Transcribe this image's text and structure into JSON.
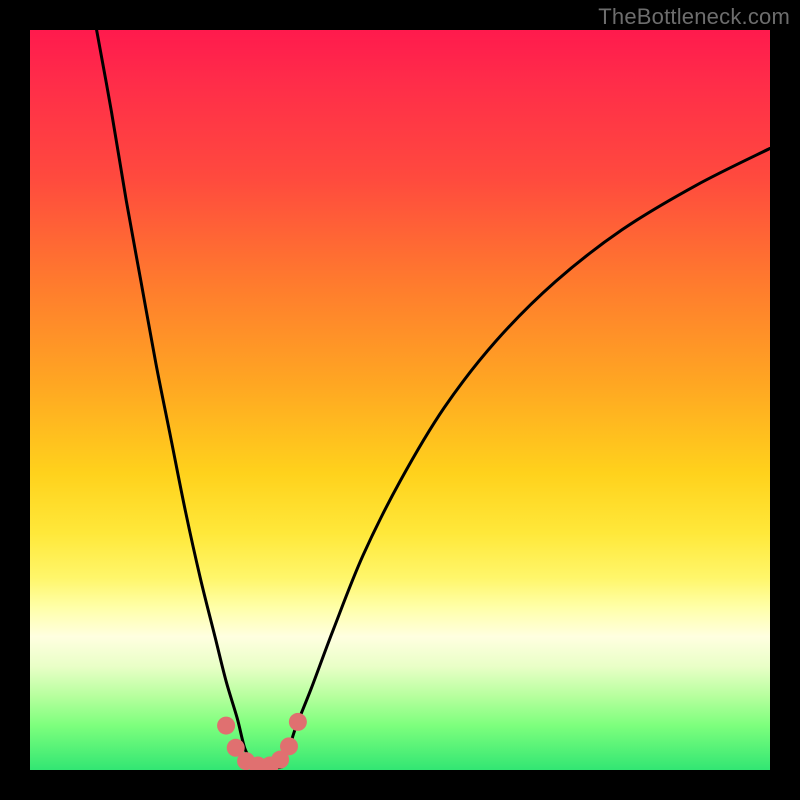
{
  "watermark": "TheBottleneck.com",
  "chart_data": {
    "type": "line",
    "title": "",
    "xlabel": "",
    "ylabel": "",
    "xlim": [
      0,
      100
    ],
    "ylim": [
      0,
      100
    ],
    "grid": false,
    "legend": false,
    "gradient_stops": [
      {
        "pos": 0,
        "color": "#ff1a4d"
      },
      {
        "pos": 20,
        "color": "#ff4a3e"
      },
      {
        "pos": 48,
        "color": "#ffa722"
      },
      {
        "pos": 68,
        "color": "#ffe83a"
      },
      {
        "pos": 82,
        "color": "#ffffe0"
      },
      {
        "pos": 100,
        "color": "#32e673"
      }
    ],
    "series": [
      {
        "name": "left-arm",
        "stroke": "#000000",
        "x": [
          9,
          11,
          13,
          15,
          17,
          19,
          21,
          23,
          25,
          26.5,
          28,
          29,
          30
        ],
        "y": [
          100,
          89,
          77,
          66,
          55,
          45,
          35,
          26,
          18,
          12,
          7,
          3,
          1
        ]
      },
      {
        "name": "right-arm",
        "stroke": "#000000",
        "x": [
          34,
          35,
          36,
          38,
          41,
          45,
          50,
          56,
          63,
          71,
          80,
          90,
          100
        ],
        "y": [
          1,
          3,
          6,
          11,
          19,
          29,
          39,
          49,
          58,
          66,
          73,
          79,
          84
        ]
      }
    ],
    "markers": {
      "name": "floor-dots",
      "color": "#e07070",
      "radius_px": 9,
      "points": [
        {
          "x": 26.5,
          "y": 6
        },
        {
          "x": 27.8,
          "y": 3
        },
        {
          "x": 29.2,
          "y": 1.2
        },
        {
          "x": 30.8,
          "y": 0.6
        },
        {
          "x": 32.4,
          "y": 0.6
        },
        {
          "x": 33.8,
          "y": 1.4
        },
        {
          "x": 35.0,
          "y": 3.2
        },
        {
          "x": 36.2,
          "y": 6.5
        }
      ]
    }
  }
}
